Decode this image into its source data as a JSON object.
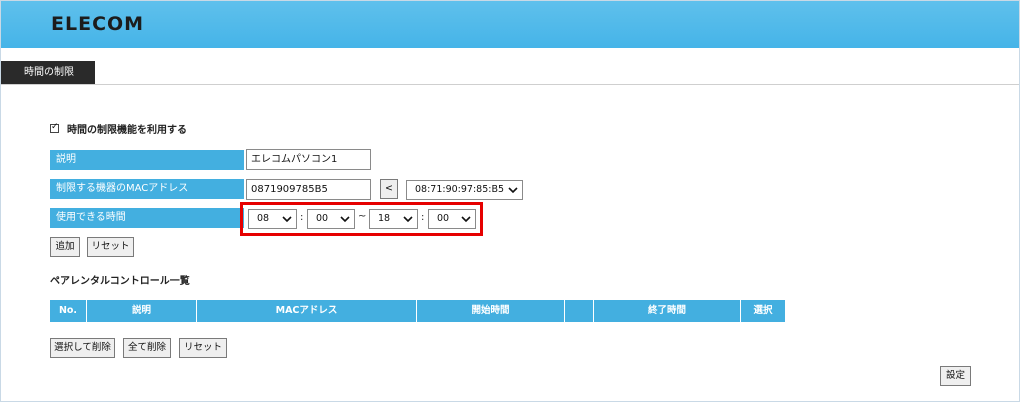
{
  "header": {
    "logo_text": "ELECOM"
  },
  "tabs": [
    {
      "label": "時間の制限",
      "active": true
    }
  ],
  "form": {
    "enable_checkbox": {
      "checked": true,
      "label": "時間の制限機能を利用する"
    },
    "description": {
      "label": "説明",
      "value": "エレコムパソコン1"
    },
    "mac": {
      "label": "制限する機器のMACアドレス",
      "value": "0871909785B5",
      "copy_button": "<",
      "selected_device": "08:71:90:97:85:B5"
    },
    "time": {
      "label": "使用できる時間",
      "start_hour": "08",
      "start_min": "00",
      "range_sep": "~",
      "colon": ":",
      "end_hour": "18",
      "end_min": "00"
    },
    "add_button": "追加",
    "reset_button": "リセット"
  },
  "list": {
    "title": "ペアレンタルコントロール一覧",
    "columns": [
      "No.",
      "説明",
      "MACアドレス",
      "開始時間",
      "",
      "終了時間",
      "選択"
    ],
    "rows": []
  },
  "actions": {
    "delete_selected": "選択して削除",
    "delete_all": "全て削除",
    "reset": "リセット",
    "apply": "設定"
  },
  "colors": {
    "header": "#45b4e8",
    "label_bg": "#43afe0",
    "highlight": "#e60000",
    "tab_bg": "#2a2a2a"
  }
}
